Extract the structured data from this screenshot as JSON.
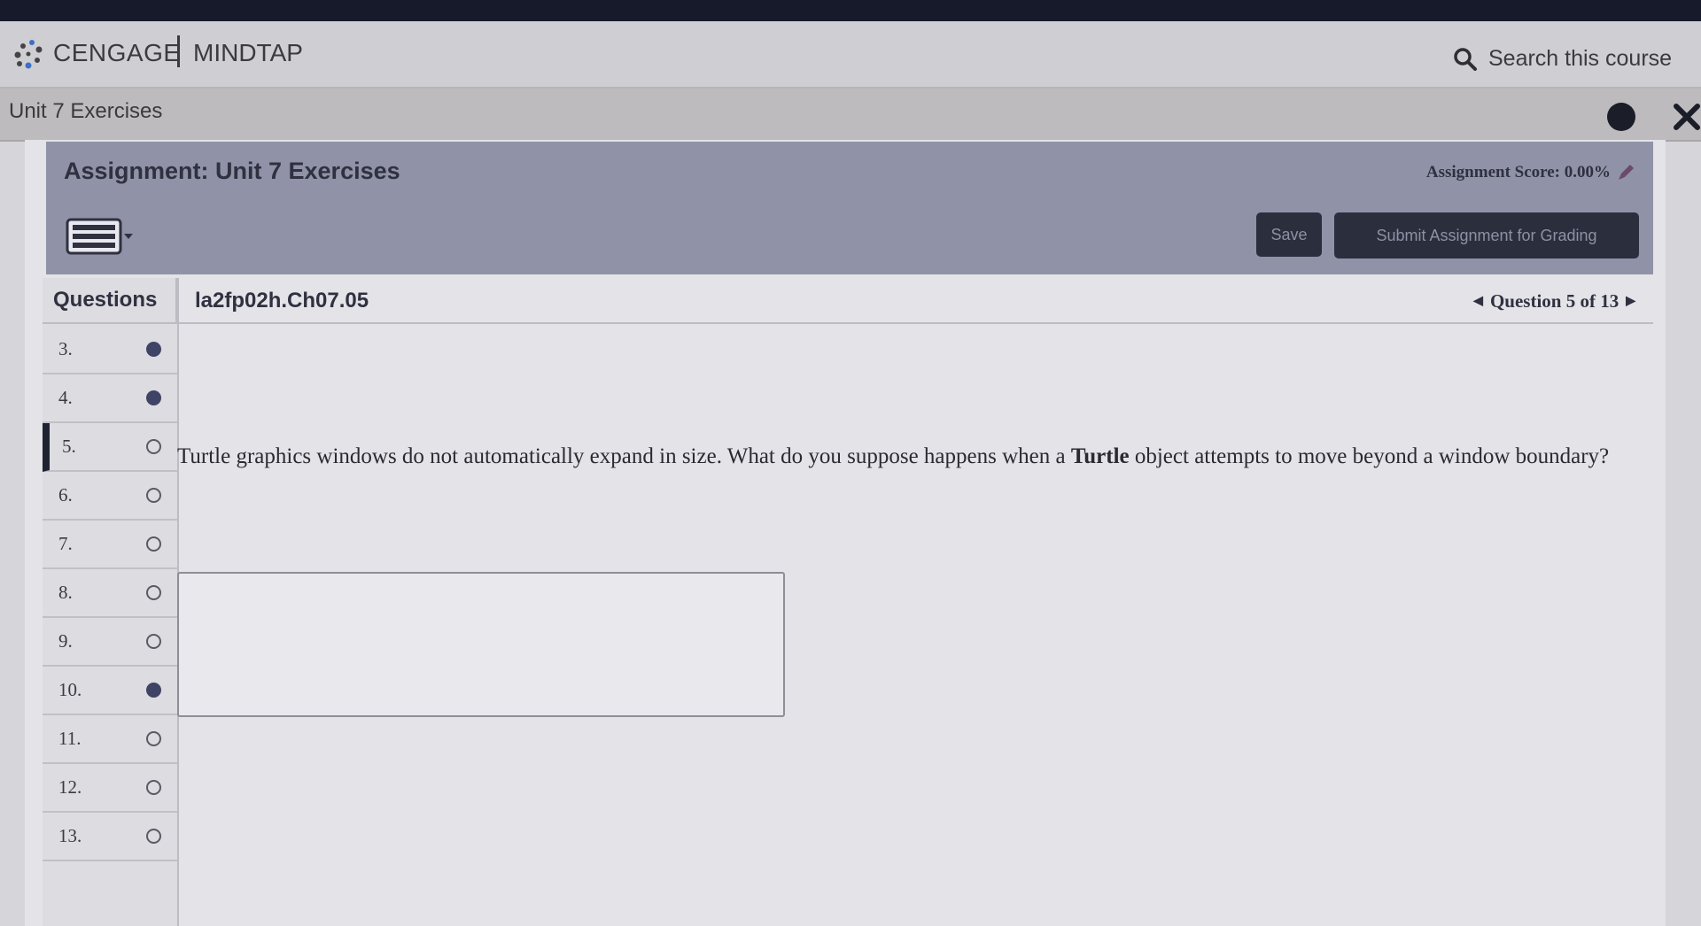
{
  "brand": {
    "name": "CENGAGE",
    "product": "MINDTAP"
  },
  "search": {
    "label": "Search this course"
  },
  "breadcrumb": {
    "title": "Unit 7 Exercises"
  },
  "assignment": {
    "title": "Assignment: Unit 7 Exercises",
    "score_label": "Assignment Score: 0.00%",
    "save_label": "Save",
    "submit_label": "Submit Assignment for Grading"
  },
  "questions_panel": {
    "header": "Questions",
    "items": [
      {
        "label": "3.",
        "status": "answered"
      },
      {
        "label": "4.",
        "status": "answered"
      },
      {
        "label": "5.",
        "status": "unanswered",
        "active": true
      },
      {
        "label": "6.",
        "status": "unanswered"
      },
      {
        "label": "7.",
        "status": "unanswered"
      },
      {
        "label": "8.",
        "status": "unanswered"
      },
      {
        "label": "9.",
        "status": "unanswered"
      },
      {
        "label": "10.",
        "status": "answered"
      },
      {
        "label": "11.",
        "status": "unanswered"
      },
      {
        "label": "12.",
        "status": "unanswered"
      },
      {
        "label": "13.",
        "status": "unanswered"
      }
    ]
  },
  "question": {
    "code": "la2fp02h.Ch07.05",
    "nav_label": "Question 5 of 13",
    "text_before": "Turtle graphics windows do not automatically expand in size. What do you suppose happens when a ",
    "text_bold": "Turtle",
    "text_after": " object attempts to move beyond a window boundary?",
    "answer_value": ""
  },
  "colors": {
    "header_band": "#9093a7",
    "answered_dot": "#3f4365",
    "top_strip": "#161a2b"
  },
  "icons": [
    "cengage-logo-icon",
    "search-icon",
    "close-icon",
    "keyboard-icon",
    "edit-pencil-icon",
    "chevron-left-icon",
    "chevron-right-icon"
  ]
}
